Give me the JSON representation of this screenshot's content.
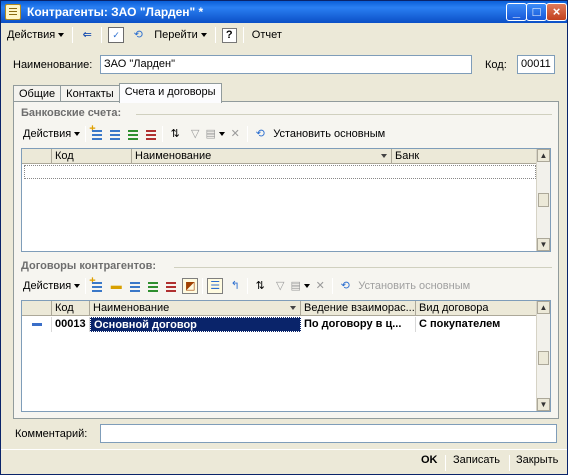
{
  "window": {
    "title": "Контрагенты: ЗАО \"Ларден\" *",
    "min_glyph": "_",
    "max_glyph": "□",
    "close_glyph": "×"
  },
  "toolbar": {
    "actions_label": "Действия",
    "goto_label": "Перейти",
    "help_glyph": "?",
    "report_label": "Отчет"
  },
  "form": {
    "name_label": "Наименование:",
    "name_value": "ЗАО \"Ларден\"",
    "code_label": "Код:",
    "code_value": "00011",
    "comment_label": "Комментарий:",
    "comment_value": ""
  },
  "tabs": [
    {
      "label": "Общие",
      "active": false
    },
    {
      "label": "Контакты",
      "active": false
    },
    {
      "label": "Счета и договоры",
      "active": true
    }
  ],
  "bank_accounts": {
    "title": "Банковские счета:",
    "actions_label": "Действия",
    "set_main_label": "Установить основным",
    "columns": [
      "Код",
      "Наименование",
      "Банк"
    ],
    "rows": []
  },
  "contracts": {
    "title": "Договоры контрагентов:",
    "actions_label": "Действия",
    "set_main_label": "Установить основным",
    "columns": [
      "Код",
      "Наименование",
      "Ведение взаиморас...",
      "Вид договора"
    ],
    "rows": [
      {
        "code": "00013",
        "name": "Основной договор",
        "mode": "По договору в ц...",
        "kind": "С покупателем"
      }
    ]
  },
  "footer": {
    "ok_label": "OK",
    "save_label": "Записать",
    "close_label": "Закрыть"
  },
  "colors": {
    "titlebar": "#0b4fc6",
    "selection": "#0a246a",
    "window_bg": "#ece9d8"
  }
}
